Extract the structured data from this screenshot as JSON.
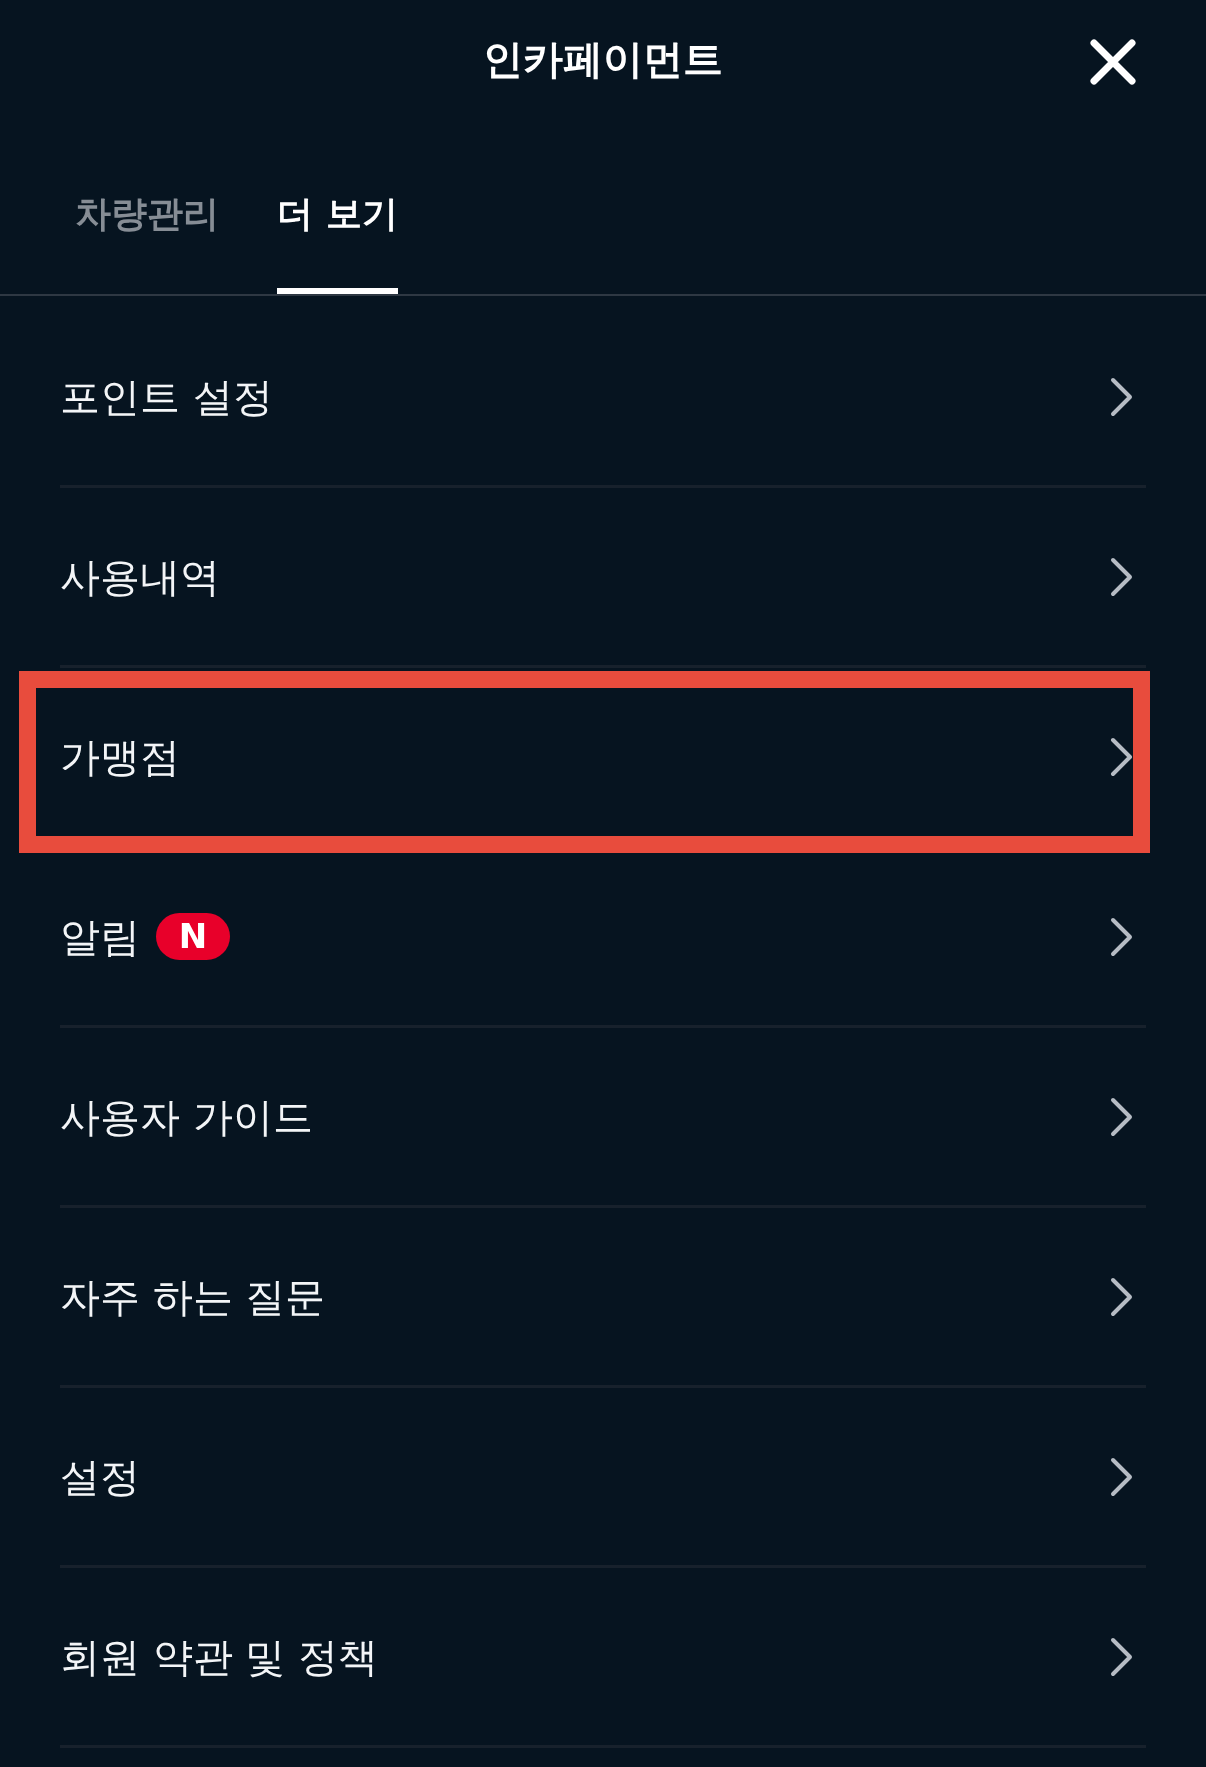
{
  "header": {
    "title": "인카페이먼트"
  },
  "tabs": [
    {
      "label": "차량관리",
      "selected": false
    },
    {
      "label": "더 보기",
      "selected": true
    }
  ],
  "menu_items": [
    {
      "label": "포인트 설정",
      "highlighted": false
    },
    {
      "label": "사용내역",
      "highlighted": false
    },
    {
      "label": "가맹점",
      "highlighted": true
    },
    {
      "label": "알림",
      "badge": "N",
      "highlighted": false
    },
    {
      "label": "사용자 가이드",
      "highlighted": false
    },
    {
      "label": "자주 하는 질문",
      "highlighted": false
    },
    {
      "label": "설정",
      "highlighted": false
    },
    {
      "label": "회원 약관 및 정책",
      "highlighted": false
    }
  ]
}
